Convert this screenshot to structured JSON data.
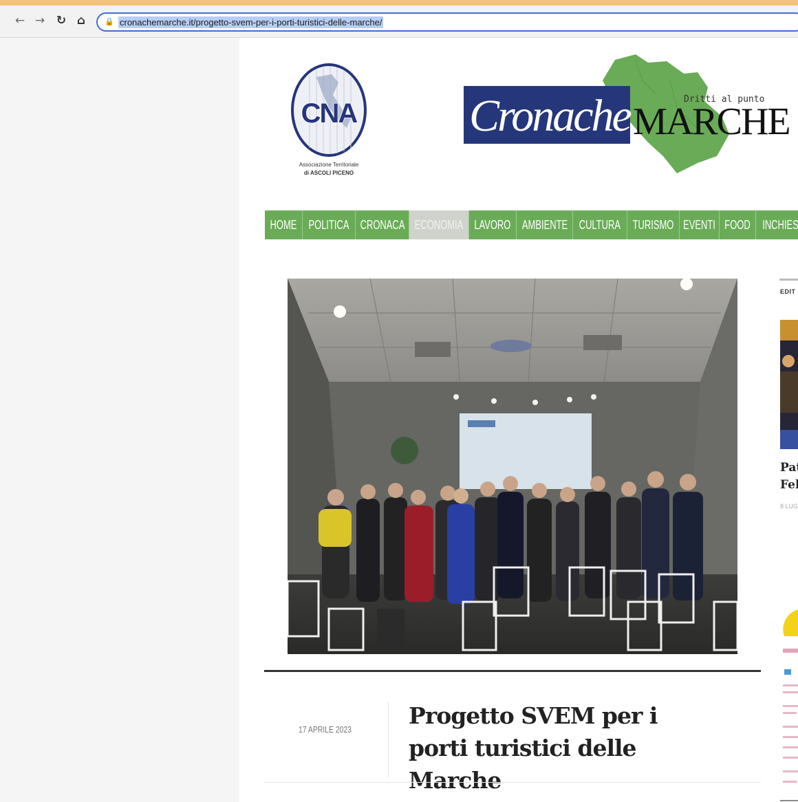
{
  "browser": {
    "back_icon": "arrow-left-icon",
    "forward_icon": "arrow-right-icon",
    "reload_icon": "reload-icon",
    "home_icon": "home-icon",
    "lock_icon": "lock-icon",
    "url": "cronachemarche.it/progetto-svem-per-i-porti-turistici-delle-marche/",
    "accent_color": "#3b6fd9"
  },
  "header": {
    "cna_logo_text": "CNA",
    "cna_caption_line1": "Associazione Territoriale",
    "cna_caption_line2": "di ASCOLI PICENO",
    "logo_cronache": "Cronache",
    "logo_marche": "MARCHE",
    "slogan": "Dritti al punto",
    "brand_blue": "#25377a",
    "brand_green": "#6aab57"
  },
  "menu": {
    "items": [
      {
        "label": "HOME"
      },
      {
        "label": "POLITICA"
      },
      {
        "label": "CRONACA"
      },
      {
        "label": "ECONOMIA",
        "active": true
      },
      {
        "label": "LAVORO"
      },
      {
        "label": "AMBIENTE"
      },
      {
        "label": "CULTURA"
      },
      {
        "label": "TURISMO"
      },
      {
        "label": "EVENTI"
      },
      {
        "label": "FOOD"
      },
      {
        "label": "INCHIES"
      }
    ]
  },
  "article": {
    "date": "17 APRILE 2023",
    "title": "Progetto SVEM per i porti turistici delle Marche"
  },
  "sidebar": {
    "label": "EDIT",
    "title_line1": "Pat",
    "title_line2": "Fell",
    "date": "8 LUG"
  }
}
